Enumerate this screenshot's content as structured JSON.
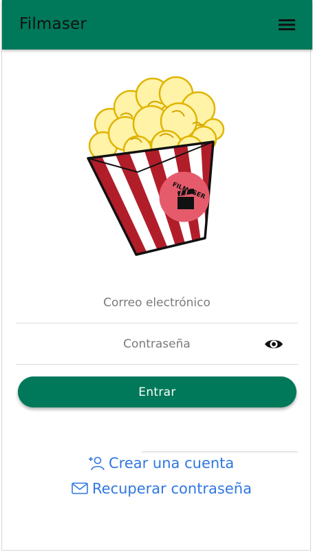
{
  "header": {
    "title": "Filmaser",
    "menu_icon": "hamburger-menu-icon",
    "background_color": "#00785a"
  },
  "logo": {
    "text": "FILMASER",
    "icon": "popcorn-clapperboard-logo"
  },
  "form": {
    "email_placeholder": "Correo electrónico",
    "password_placeholder": "Contraseña",
    "password_toggle_icon": "eye-icon",
    "submit_label": "Entrar",
    "accent_color": "#00785a"
  },
  "links": {
    "create_account": "Crear una cuenta",
    "create_account_icon": "add-user-icon",
    "recover_password": "Recuperar contraseña",
    "recover_password_icon": "envelope-icon",
    "link_color": "#2f77e0"
  }
}
